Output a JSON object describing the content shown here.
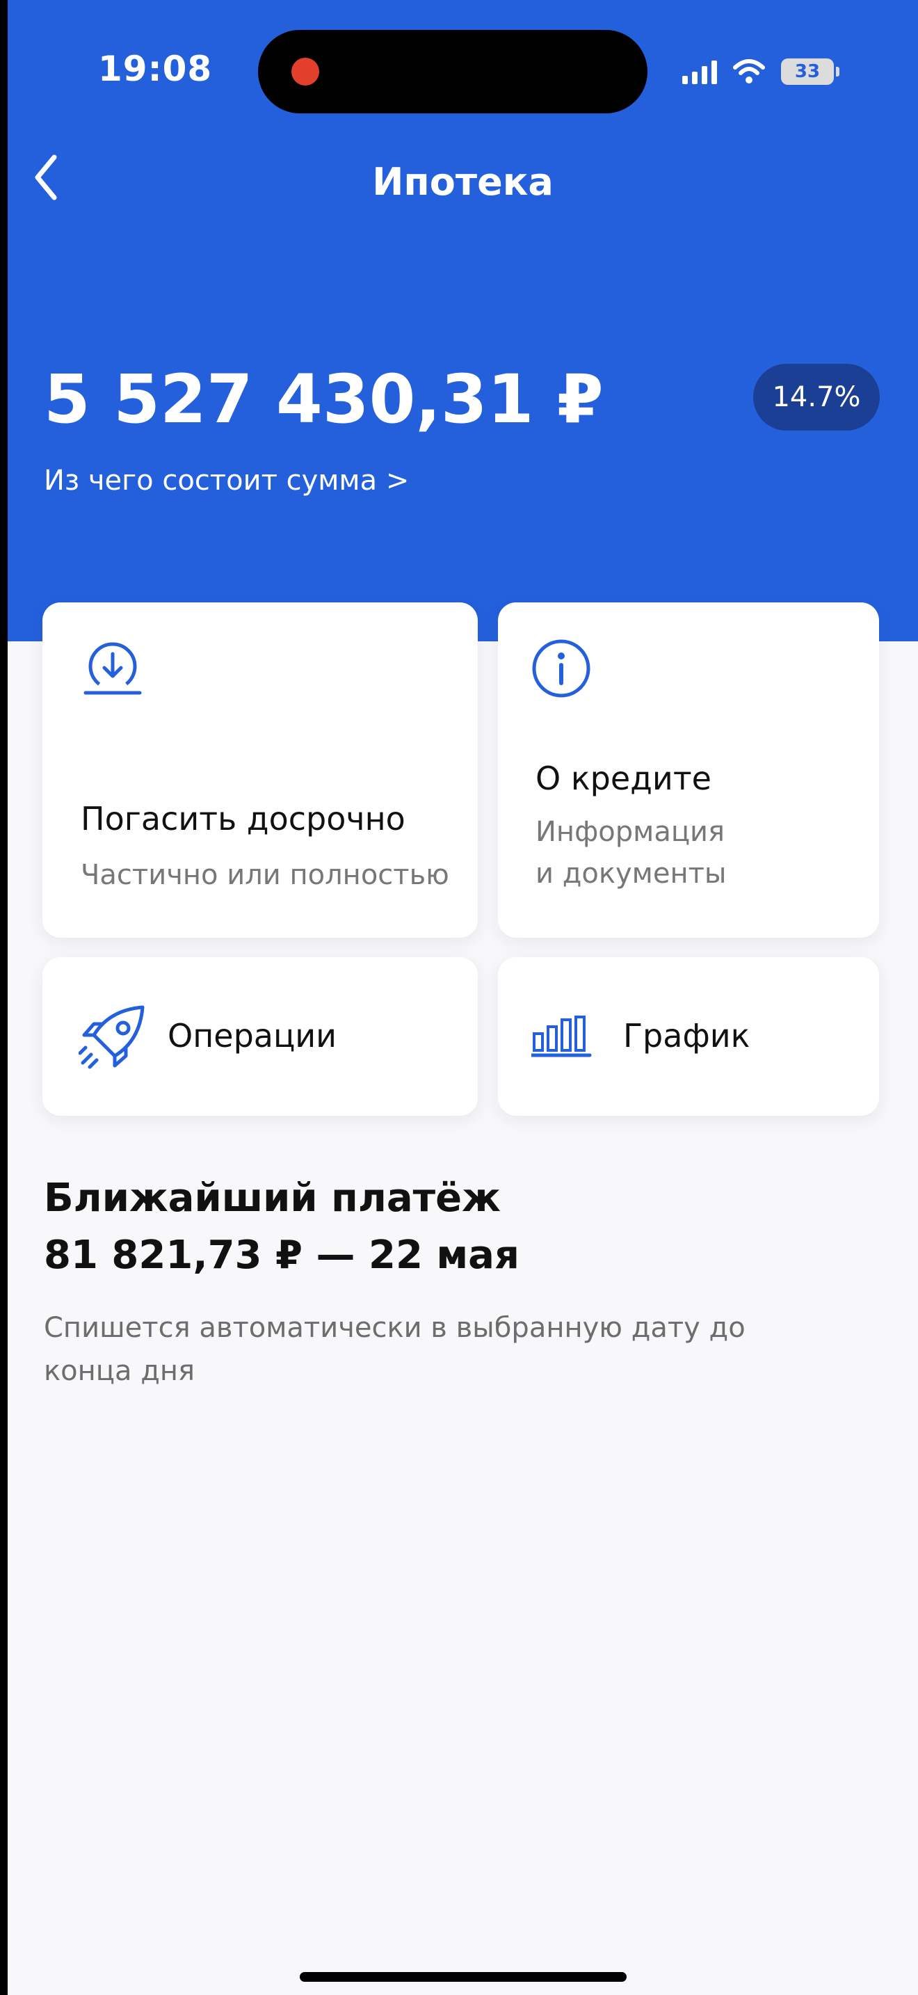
{
  "colors": {
    "accent": "#2460dc",
    "badge_bg": "#1b3f95",
    "background": "#f8f8fa",
    "card": "#ffffff",
    "icon": "#2460dc",
    "recording_dot": "#e2402c"
  },
  "status_bar": {
    "time": "19:08",
    "battery": "33",
    "icons": [
      "signal-icon",
      "wifi-icon",
      "battery-icon"
    ]
  },
  "header": {
    "title": "Ипотека",
    "back_icon": "chevron-left-icon"
  },
  "balance": {
    "amount": "5 527 430,31 ₽",
    "rate": "14.7%",
    "breakdown_link": "Из чего состоит сумма >"
  },
  "actions": [
    {
      "icon": "download-arrow-icon",
      "title": "Погасить досрочно",
      "subtitle": "Частично или полностью"
    },
    {
      "icon": "info-icon",
      "title": "О кредите",
      "subtitle_line1": "Информация",
      "subtitle_line2": "и документы"
    },
    {
      "icon": "rocket-icon",
      "title": "Операции"
    },
    {
      "icon": "bar-chart-icon",
      "title": "График"
    }
  ],
  "next_payment": {
    "title": "Ближайший платёж",
    "amount_date": "81 821,73 ₽ — 22 мая",
    "note": "Спишется автоматически в выбранную дату до конца дня"
  }
}
